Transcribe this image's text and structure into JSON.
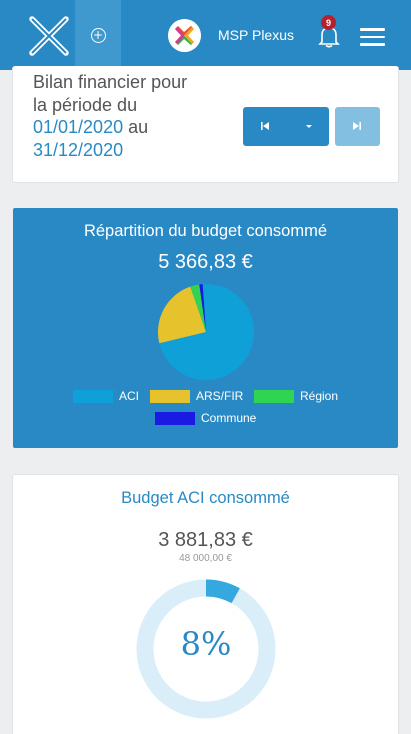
{
  "header": {
    "org_name": "MSP Plexus",
    "notification_count": "9",
    "logo_icon": "plexus-x-logo",
    "add_icon": "plus-circle-icon",
    "menu_icon": "hamburger-menu-icon",
    "bell_icon": "bell-icon"
  },
  "period": {
    "line1": "Bilan financier pour",
    "line2": "la période du",
    "start_date": "01/01/2020",
    "connector": "au",
    "end_date": "31/12/2020",
    "first_icon": "skip-first-icon",
    "dropdown_icon": "caret-down-icon",
    "last_icon": "skip-last-icon"
  },
  "budget": {
    "title": "Répartition du budget consommé",
    "total": "5 366,83 €",
    "colors": {
      "card": "#2989c5",
      "aci": "#0fa0d8",
      "ars": "#e6c32d",
      "region": "#2ed452",
      "commune": "#1b1ae2"
    }
  },
  "chart_data": {
    "type": "pie",
    "title": "Répartition du budget consommé",
    "categories": [
      "ACI",
      "ARS/FIR",
      "Région",
      "Commune"
    ],
    "values": [
      3881.83,
      1260.0,
      165.0,
      60.0
    ],
    "legend_position": "bottom"
  },
  "aci": {
    "title": "Budget ACI consommé",
    "amount": "3 881,83 €",
    "max": "48 000,00 €",
    "percent_label": "8%",
    "percent_value": 0.081
  }
}
